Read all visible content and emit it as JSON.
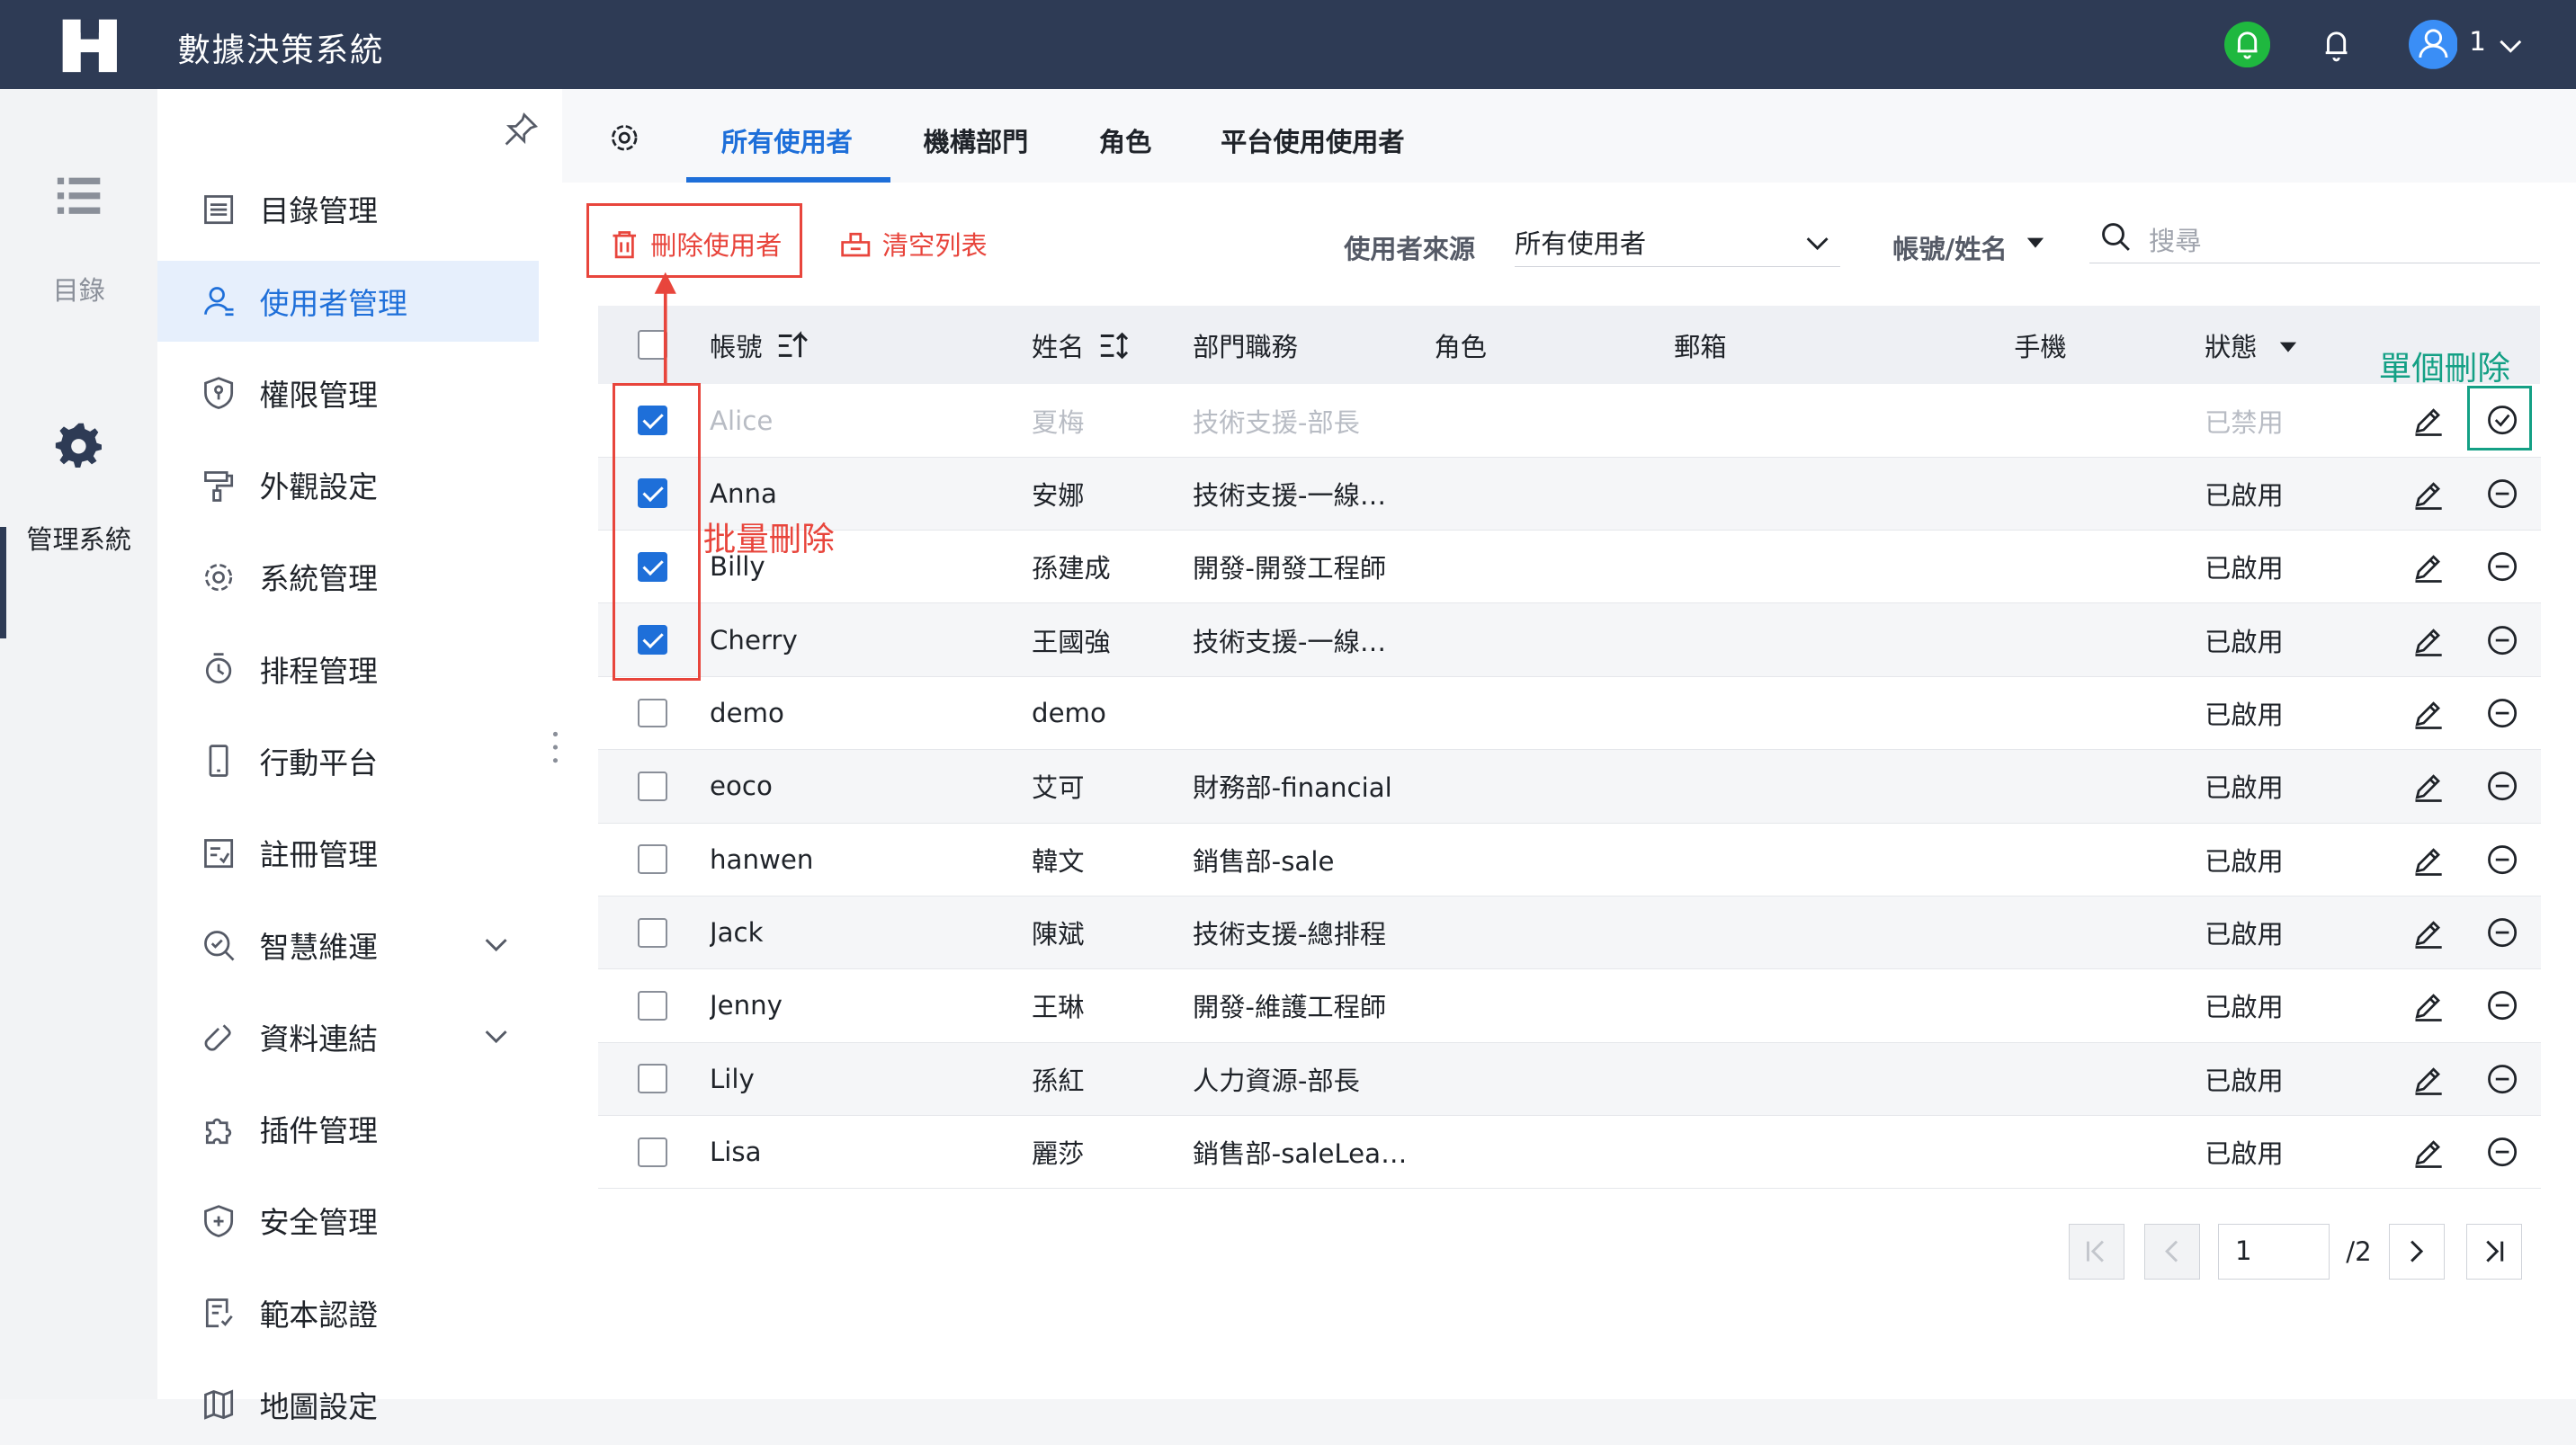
{
  "app": {
    "title": "數據決策系統",
    "user": "1"
  },
  "rail": [
    {
      "label": "目錄"
    },
    {
      "label": "管理系統"
    }
  ],
  "menu": {
    "items": [
      {
        "label": "目錄管理"
      },
      {
        "label": "使用者管理"
      },
      {
        "label": "權限管理"
      },
      {
        "label": "外觀設定"
      },
      {
        "label": "系統管理"
      },
      {
        "label": "排程管理"
      },
      {
        "label": "行動平台"
      },
      {
        "label": "註冊管理"
      },
      {
        "label": "智慧維運"
      },
      {
        "label": "資料連結"
      },
      {
        "label": "插件管理"
      },
      {
        "label": "安全管理"
      },
      {
        "label": "範本認證"
      },
      {
        "label": "地圖設定"
      }
    ]
  },
  "tabs": [
    {
      "label": "所有使用者"
    },
    {
      "label": "機構部門"
    },
    {
      "label": "角色"
    },
    {
      "label": "平台使用使用者"
    }
  ],
  "toolbar": {
    "delete_users": "刪除使用者",
    "clear_list": "清空列表",
    "source_label": "使用者來源",
    "source_value": "所有使用者",
    "account_filter": "帳號/姓名",
    "search_placeholder": "搜尋"
  },
  "table": {
    "headers": {
      "account": "帳號",
      "name": "姓名",
      "dept": "部門職務",
      "role": "角色",
      "email": "郵箱",
      "phone": "手機",
      "status": "狀態"
    },
    "rows": [
      {
        "account": "Alice",
        "name": "夏梅",
        "dept": "技術支援-部長",
        "role": "",
        "email": "",
        "phone": "",
        "status": "已禁用"
      },
      {
        "account": "Anna",
        "name": "安娜",
        "dept": "技術支援-一線…",
        "role": "",
        "email": "",
        "phone": "",
        "status": "已啟用"
      },
      {
        "account": "Billy",
        "name": "孫建成",
        "dept": "開發-開發工程師",
        "role": "",
        "email": "",
        "phone": "",
        "status": "已啟用"
      },
      {
        "account": "Cherry",
        "name": "王國強",
        "dept": "技術支援-一線…",
        "role": "",
        "email": "",
        "phone": "",
        "status": "已啟用"
      },
      {
        "account": "demo",
        "name": "demo",
        "dept": "",
        "role": "",
        "email": "",
        "phone": "",
        "status": "已啟用"
      },
      {
        "account": "eoco",
        "name": "艾可",
        "dept": "財務部-financial",
        "role": "",
        "email": "",
        "phone": "",
        "status": "已啟用"
      },
      {
        "account": "hanwen",
        "name": "韓文",
        "dept": "銷售部-sale",
        "role": "",
        "email": "",
        "phone": "",
        "status": "已啟用"
      },
      {
        "account": "Jack",
        "name": "陳斌",
        "dept": "技術支援-總排程",
        "role": "",
        "email": "",
        "phone": "",
        "status": "已啟用"
      },
      {
        "account": "Jenny",
        "name": "王琳",
        "dept": "開發-維護工程師",
        "role": "",
        "email": "",
        "phone": "",
        "status": "已啟用"
      },
      {
        "account": "Lily",
        "name": "孫紅",
        "dept": "人力資源-部長",
        "role": "",
        "email": "",
        "phone": "",
        "status": "已啟用"
      },
      {
        "account": "Lisa",
        "name": "麗莎",
        "dept": "銷售部-saleLea…",
        "role": "",
        "email": "",
        "phone": "",
        "status": "已啟用"
      }
    ]
  },
  "annotations": {
    "batch_delete": "批量刪除",
    "single_delete": "單個刪除"
  },
  "pager": {
    "current": "1",
    "total": "/2"
  },
  "colors": {
    "topbar": "#2e3b55",
    "accent": "#1e6fd9",
    "highlight_red": "#e8453c",
    "highlight_green": "#14a085",
    "notify_green": "#1fb83f"
  }
}
